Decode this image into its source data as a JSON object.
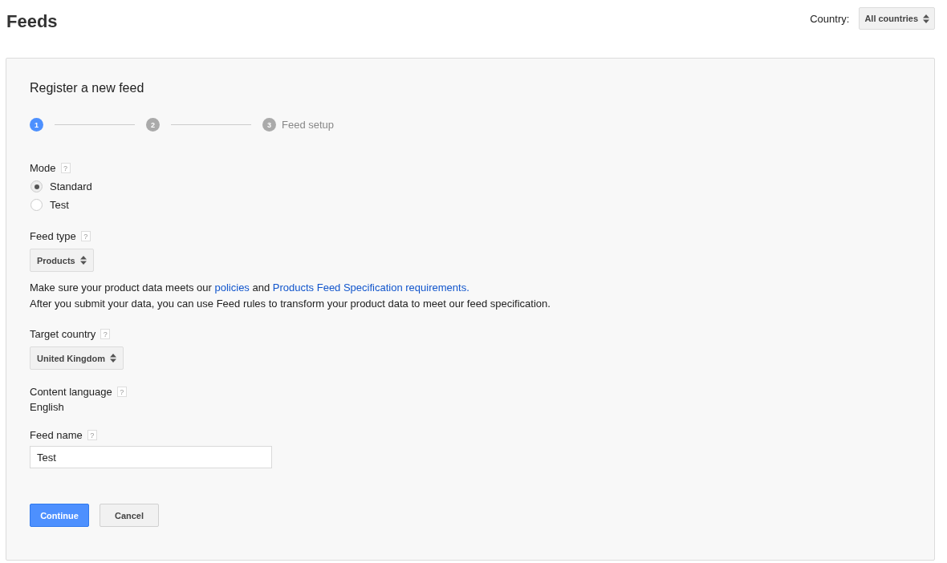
{
  "page_title": "Feeds",
  "country_filter": {
    "label": "Country:",
    "value": "All countries"
  },
  "panel": {
    "title": "Register a new feed",
    "steps": [
      {
        "number": "1",
        "selected": true
      },
      {
        "number": "2",
        "selected": false
      },
      {
        "number": "3",
        "label": "Feed setup",
        "selected": false
      }
    ],
    "fields": [
      {
        "kind": "radio",
        "label": "Mode",
        "help": "?",
        "options": [
          {
            "label": "Standard",
            "selected": true
          },
          {
            "label": "Test",
            "selected": false
          }
        ]
      },
      {
        "kind": "select",
        "label": "Feed type",
        "help": "?",
        "value": "Products",
        "notes": [
          [
            {
              "text": "Make sure your product data meets our "
            },
            {
              "link": "policies"
            },
            {
              "text": " and "
            },
            {
              "link": "Products Feed Specification requirements."
            }
          ],
          [
            {
              "text": "After you submit your data, you can use Feed rules to transform your product data to meet our feed specification."
            }
          ]
        ]
      },
      {
        "kind": "select",
        "label": "Target country",
        "help": "?",
        "value": "United Kingdom"
      },
      {
        "kind": "static",
        "label": "Content language",
        "help": "?",
        "value": "English"
      },
      {
        "kind": "text",
        "label": "Feed name",
        "help": "?",
        "value": "Test"
      }
    ],
    "buttons": [
      {
        "label": "Continue",
        "kind": "primary"
      },
      {
        "label": "Cancel",
        "kind": "secondary"
      }
    ]
  }
}
